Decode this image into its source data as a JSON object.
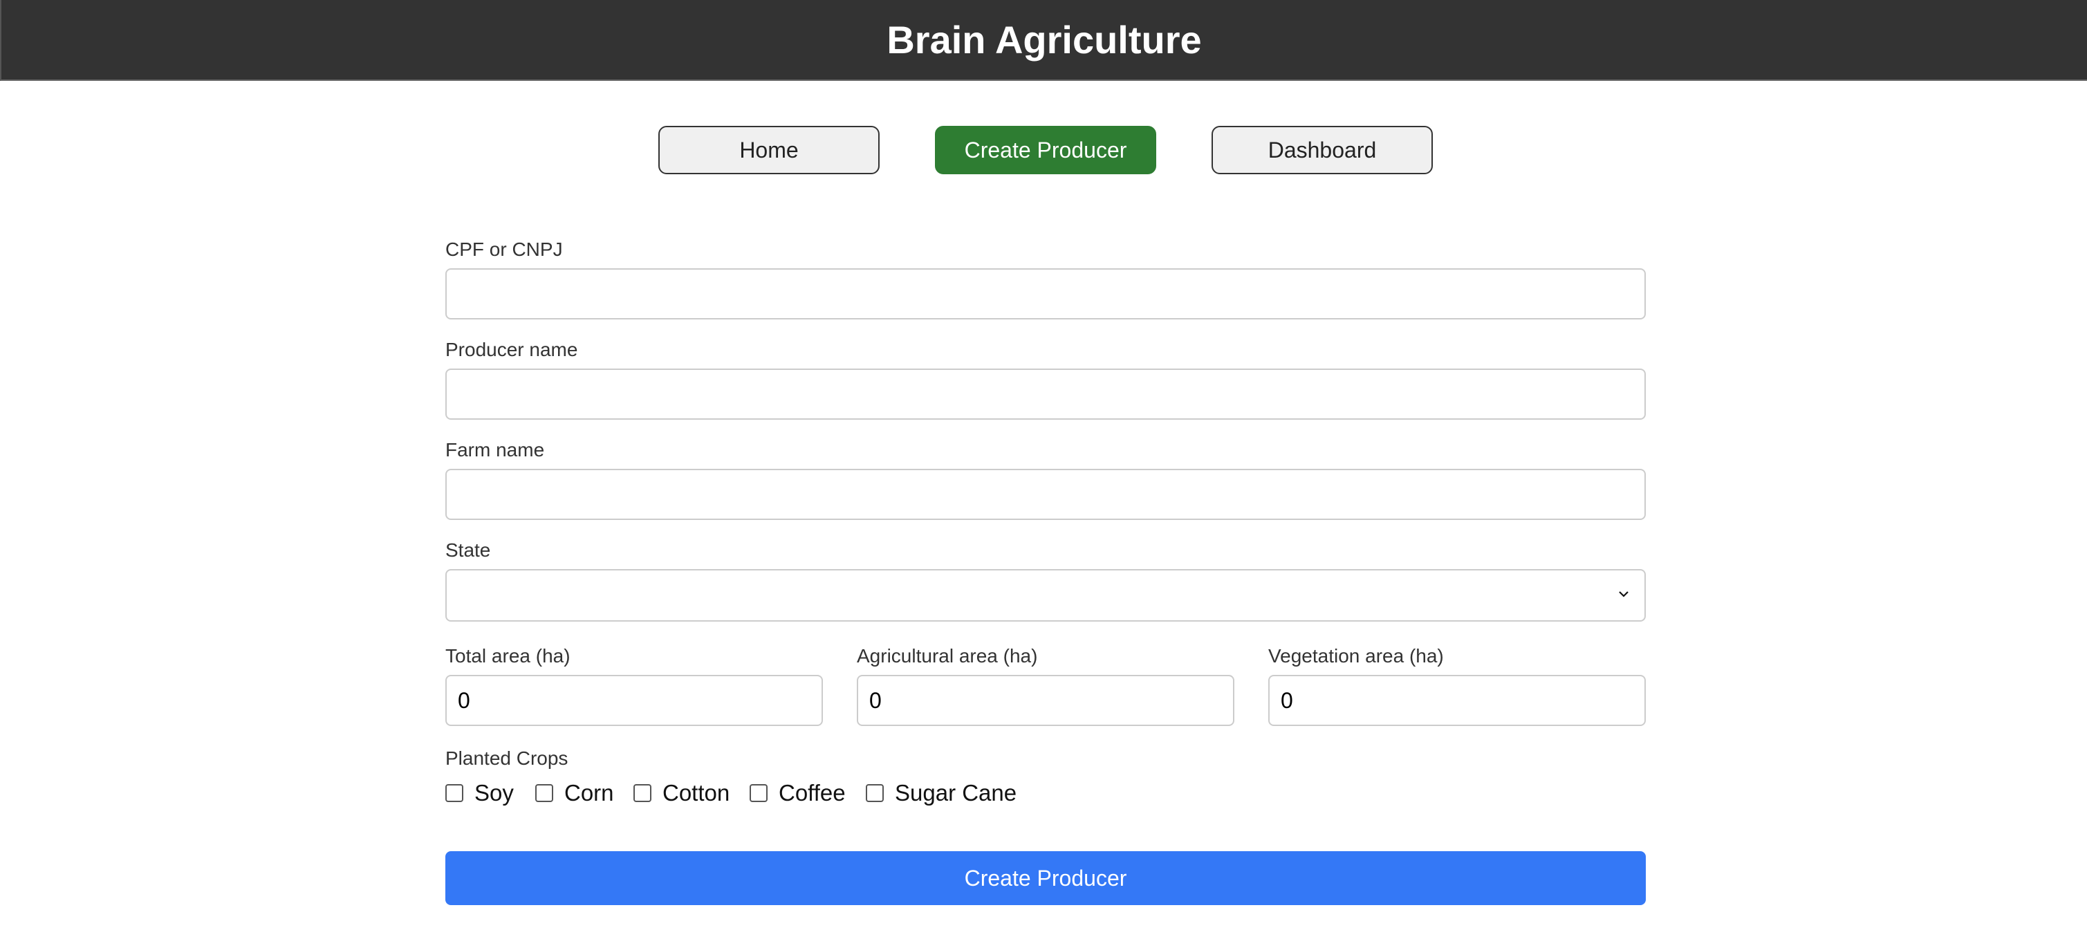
{
  "header": {
    "title": "Brain Agriculture"
  },
  "nav": {
    "home": "Home",
    "create_producer": "Create Producer",
    "dashboard": "Dashboard"
  },
  "form": {
    "cpf_label": "CPF or CNPJ",
    "cpf_value": "",
    "producer_name_label": "Producer name",
    "producer_name_value": "",
    "farm_name_label": "Farm name",
    "farm_name_value": "",
    "state_label": "State",
    "state_value": "",
    "total_area_label": "Total area (ha)",
    "total_area_value": "0",
    "agricultural_area_label": "Agricultural area (ha)",
    "agricultural_area_value": "0",
    "vegetation_area_label": "Vegetation area (ha)",
    "vegetation_area_value": "0",
    "crops_label": "Planted Crops",
    "crops": [
      {
        "label": "Soy",
        "checked": false
      },
      {
        "label": "Corn",
        "checked": false
      },
      {
        "label": "Cotton",
        "checked": false
      },
      {
        "label": "Coffee",
        "checked": false
      },
      {
        "label": "Sugar Cane",
        "checked": false
      }
    ],
    "submit_label": "Create Producer"
  },
  "colors": {
    "header_bg": "#333333",
    "active_nav": "#2e7d32",
    "submit_bg": "#3478f6"
  }
}
